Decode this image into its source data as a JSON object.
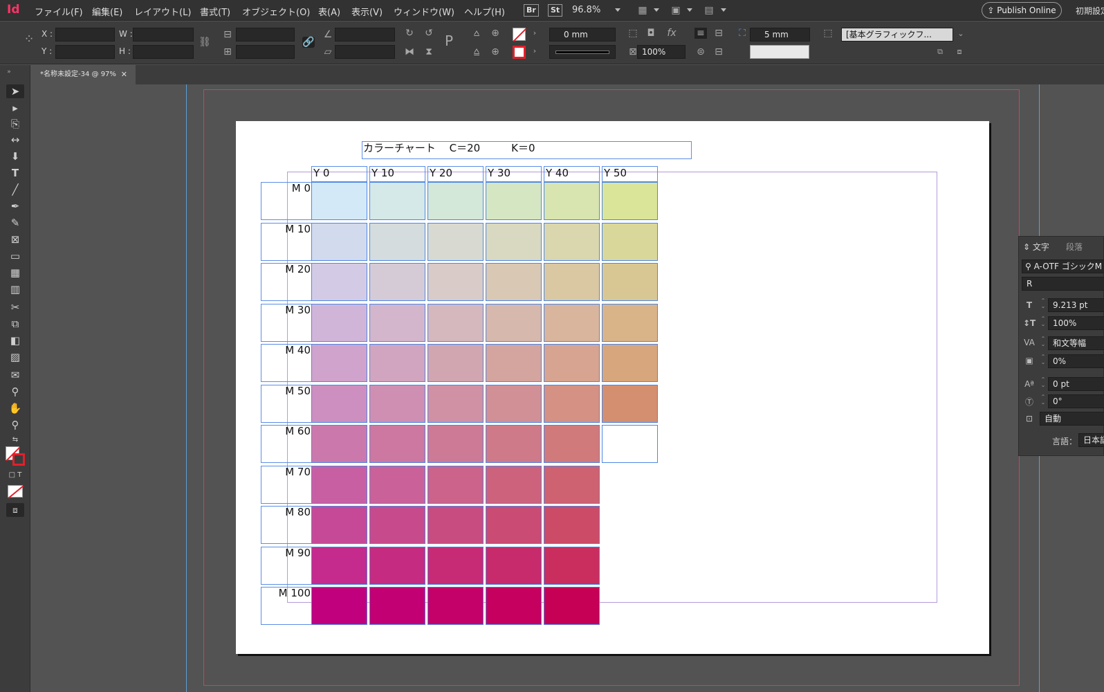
{
  "menubar": {
    "app_logo": "Id",
    "items": [
      "ファイル(F)",
      "編集(E)",
      "レイアウト(L)",
      "書式(T)",
      "オブジェクト(O)",
      "表(A)",
      "表示(V)",
      "ウィンドウ(W)",
      "ヘルプ(H)"
    ],
    "bridge": "Br",
    "stock": "St",
    "zoom": "96.8%",
    "publish": "Publish Online",
    "workspace": "初期設定"
  },
  "control": {
    "x_label": "X :",
    "y_label": "Y :",
    "w_label": "W :",
    "h_label": "H :",
    "stroke_weight": "0 mm",
    "opacity": "100%",
    "offset": "5 mm",
    "object_style": "[基本グラフィックフ..."
  },
  "doc_tab": {
    "title": "*名称未設定-34 @ 97%"
  },
  "chart": {
    "title": "カラーチャート　 C＝20　　　K＝0",
    "y_headers": [
      "Y 0",
      "Y 10",
      "Y 20",
      "Y 30",
      "Y 40",
      "Y 50"
    ],
    "m_labels": [
      "M 0",
      "M 10",
      "M 20",
      "M 30",
      "M 40",
      "M 50",
      "M 60",
      "M 70",
      "M 80",
      "M 90",
      "M 100"
    ],
    "swatches": [
      [
        "#d4e9f8",
        "#d4e9e8",
        "#d4e8d9",
        "#d5e6c3",
        "#d8e5b0",
        "#dae599"
      ],
      [
        "#d2daed",
        "#d5dcdd",
        "#d8dad1",
        "#d9d9c1",
        "#dad7ae",
        "#dad79a"
      ],
      [
        "#d3cbe5",
        "#d5cbd7",
        "#d8cbc8",
        "#d9c8b4",
        "#dac8a3",
        "#d9c793"
      ],
      [
        "#d1b5d9",
        "#d3b6cc",
        "#d5b8bd",
        "#d6b8ad",
        "#d8b59c",
        "#d9b488"
      ],
      [
        "#cfa3cb",
        "#d1a5c0",
        "#d2a6b1",
        "#d4a59f",
        "#d6a490",
        "#d8a67d"
      ],
      [
        "#cd8fbf",
        "#cf8fb2",
        "#d091a5",
        "#d19096",
        "#d49184",
        "#d48f70"
      ],
      [
        "#cb79ad",
        "#cc78a1",
        "#cd7a96",
        "#cf7a88",
        "#d17a7b",
        "#ffffff"
      ],
      [
        "#c95fa3",
        "#ca6299",
        "#cb638b",
        "#cd627d",
        "#cf6270"
      ],
      [
        "#c64997",
        "#c74b8c",
        "#c94c80",
        "#ca4b74",
        "#cc4b67"
      ],
      [
        "#c42b8c",
        "#c52b80",
        "#c72b76",
        "#c82b6b",
        "#ca2e5f"
      ],
      [
        "#c0007d",
        "#c20073",
        "#c40069",
        "#c5005f",
        "#c60055"
      ]
    ]
  },
  "char_panel": {
    "tab_char": "文字",
    "tab_para": "段落",
    "font": "A-OTF ゴシックM",
    "style": "R",
    "size": "9.213 pt",
    "leading": "100%",
    "kerning": "和文等幅",
    "tsume": "0%",
    "baseline": "0 pt",
    "rotation": "0°",
    "auto": "自動",
    "lang_label": "言語：",
    "lang": "日本語"
  }
}
